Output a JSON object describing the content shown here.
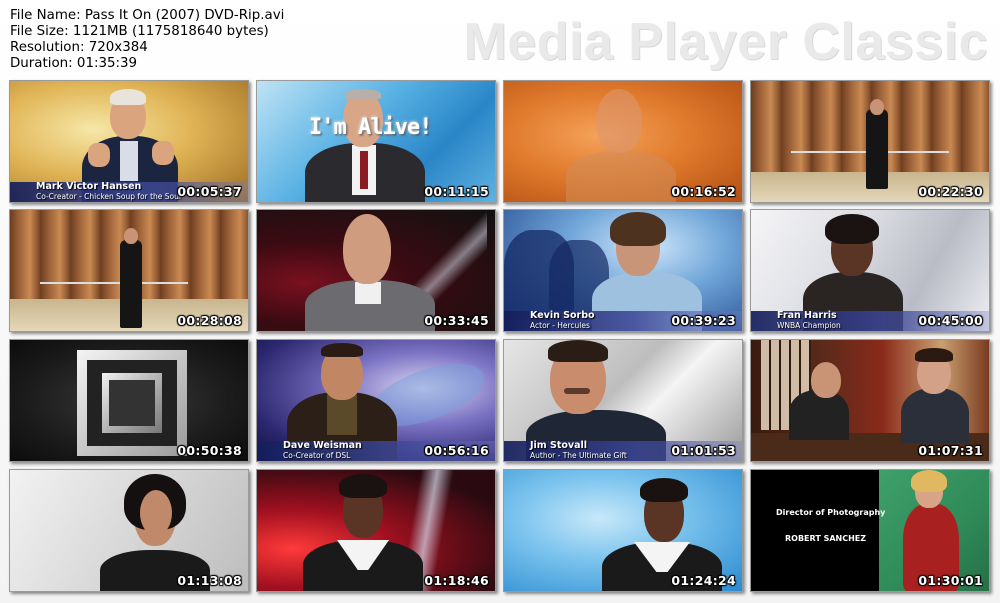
{
  "file_info": {
    "name": "File Name: Pass It On (2007) DVD-Rip.avi",
    "size": "File Size: 1121MB (1175818640 bytes)",
    "resolution": "Resolution: 720x384",
    "duration": "Duration: 01:35:39"
  },
  "brand": "Media Player Classic",
  "thumbnails": [
    {
      "time": "00:05:37",
      "name": "Mark Victor Hansen",
      "sub": "Co-Creator - Chicken Soup for the Soul"
    },
    {
      "time": "00:11:15",
      "overlay": "I'm Alive!"
    },
    {
      "time": "00:16:52"
    },
    {
      "time": "00:22:30"
    },
    {
      "time": "00:28:08"
    },
    {
      "time": "00:33:45"
    },
    {
      "time": "00:39:23",
      "name": "Kevin Sorbo",
      "sub": "Actor - Hercules"
    },
    {
      "time": "00:45:00",
      "name": "Fran Harris",
      "sub": "WNBA Champion"
    },
    {
      "time": "00:50:38"
    },
    {
      "time": "00:56:16",
      "name": "Dave Weisman",
      "sub": "Co-Creator of DSL"
    },
    {
      "time": "01:01:53",
      "name": "Jim Stovall",
      "sub": "Author - The Ultimate Gift"
    },
    {
      "time": "01:07:31"
    },
    {
      "time": "01:13:08"
    },
    {
      "time": "01:18:46"
    },
    {
      "time": "01:24:24"
    },
    {
      "time": "01:30:01",
      "credit_title": "Director of Photography",
      "credit_name": "ROBERT SANCHEZ"
    }
  ]
}
